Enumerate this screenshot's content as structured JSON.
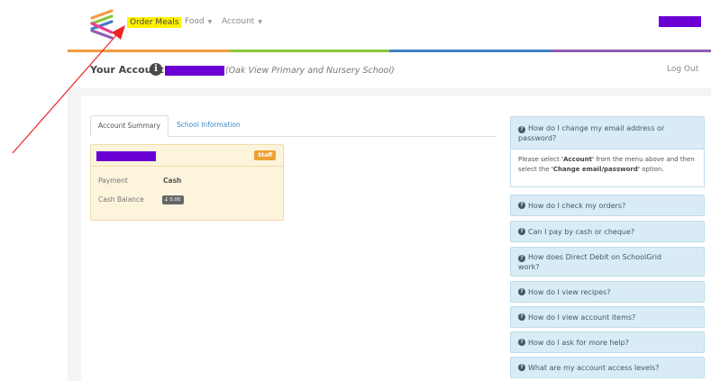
{
  "nav": {
    "order_meals": "Order Meals",
    "food": "Food",
    "account": "Account",
    "caret": "▼"
  },
  "colors": {
    "stripe": [
      "#f39c43",
      "#8cc63f",
      "#3f7fc6",
      "#8e5fb5"
    ],
    "redaction": "#6a00d4",
    "highlight": "#fff200",
    "annotation_arrow": "#ee2222"
  },
  "header": {
    "title": "Your Account",
    "info_icon": "i",
    "school": "(Oak View Primary and Nursery School)",
    "logout": "Log Out"
  },
  "tabs": {
    "summary": "Account Summary",
    "school_info": "School Information"
  },
  "account_card": {
    "badge": "Staff",
    "payment_label": "Payment",
    "payment_value": "Cash",
    "balance_label": "Cash Balance",
    "balance_value": "£ 0.00"
  },
  "faq": {
    "q1_line1": "How do I change my email address or",
    "q1_line2": "password?",
    "a1_pre": "Please select ",
    "a1_account": "'Account'",
    "a1_mid": " from the menu above and then select the ",
    "a1_change": "'Change email/password'",
    "a1_post": " option.",
    "q2": "How do I check my orders?",
    "q3": "Can I pay by cash or cheque?",
    "q4_line1": "How does Direct Debit on SchoolGrid",
    "q4_line2": "work?",
    "q5": "How do I view recipes?",
    "q6": "How do I view account items?",
    "q7": "How do I ask for more help?",
    "q8": "What are my account access levels?",
    "icon": "?"
  }
}
